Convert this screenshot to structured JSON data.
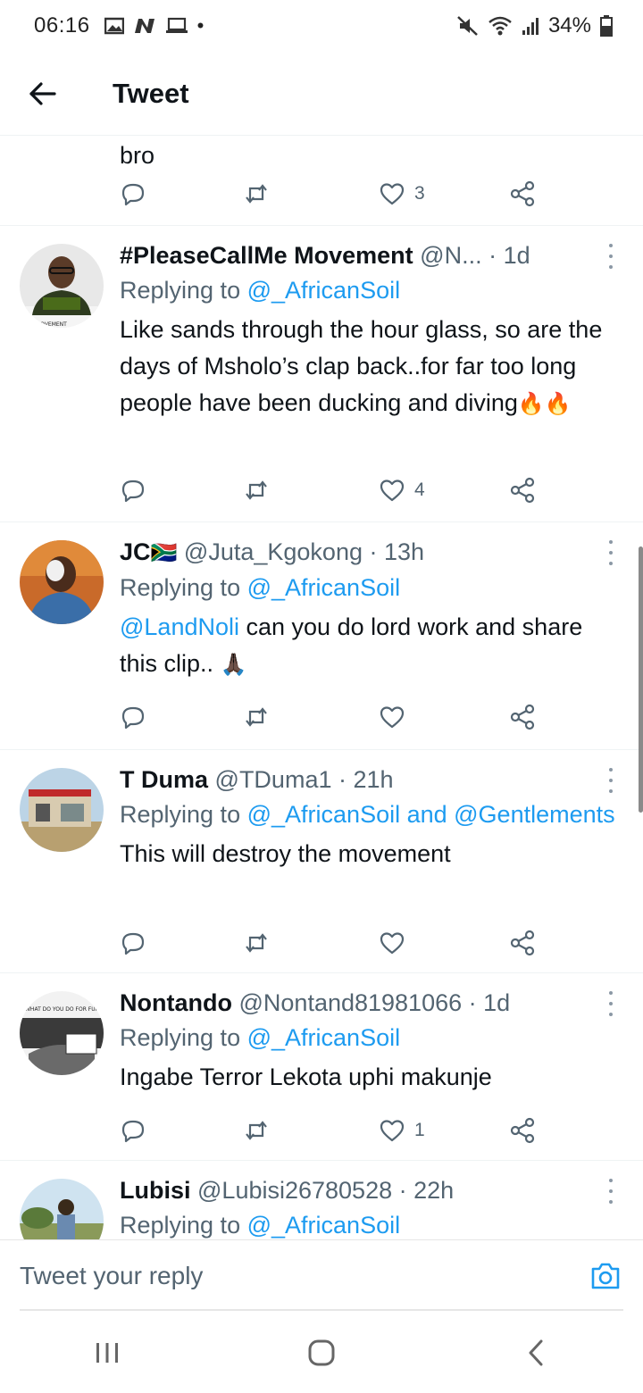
{
  "status_bar": {
    "time": "06:16",
    "battery": "34%",
    "icons_left": [
      "gallery-icon",
      "n-icon",
      "laptop-icon"
    ],
    "icons_right": [
      "mute-icon",
      "wifi-icon",
      "signal-icon",
      "battery-icon"
    ]
  },
  "header": {
    "title": "Tweet"
  },
  "partial_tweet": {
    "text": "bro",
    "like_count": "3"
  },
  "tweets": [
    {
      "name": "#PleaseCallMe Movement",
      "handle": "@N...",
      "time": "· 1d",
      "replying_label": "Replying to",
      "replying_to": "@_AfricanSoil",
      "text": "Like sands through the hour glass, so are the days of Msholo’s clap back..for far too long people have been ducking and diving",
      "emoji": "🔥🔥",
      "like_count": "4",
      "avatar_label": "MOVEMENT"
    },
    {
      "name": "JC",
      "flag": "🇿🇦",
      "handle": "@Juta_Kgokong",
      "time": "· 13h",
      "replying_label": "Replying to",
      "replying_to": "@_AfricanSoil",
      "mention": "@LandNoli",
      "text": " can you do lord work and share this clip.. ",
      "emoji": "🙏🏿",
      "like_count": ""
    },
    {
      "name": "T Duma",
      "handle": "@TDuma1",
      "time": "· 21h",
      "replying_label": "Replying to",
      "replying_to": "@_AfricanSoil and @Gentlements",
      "text": "This will destroy the movement",
      "like_count": ""
    },
    {
      "name": "Nontando",
      "handle": "@Nontand81981066",
      "time": "· 1d",
      "replying_label": "Replying to",
      "replying_to": "@_AfricanSoil",
      "text": "Ingabe Terror Lekota uphi makunje",
      "like_count": "1",
      "avatar_label": "WHAT DO YOU DO FOR FUN?"
    },
    {
      "name": "Lubisi",
      "handle": "@Lubisi26780528",
      "time": "· 22h",
      "replying_label": "Replying to",
      "replying_to": "@_AfricanSoil"
    }
  ],
  "compose": {
    "placeholder": "Tweet your reply"
  },
  "colors": {
    "accent": "#1d9bf0",
    "secondary_text": "#536471",
    "primary_text": "#0f1419"
  }
}
